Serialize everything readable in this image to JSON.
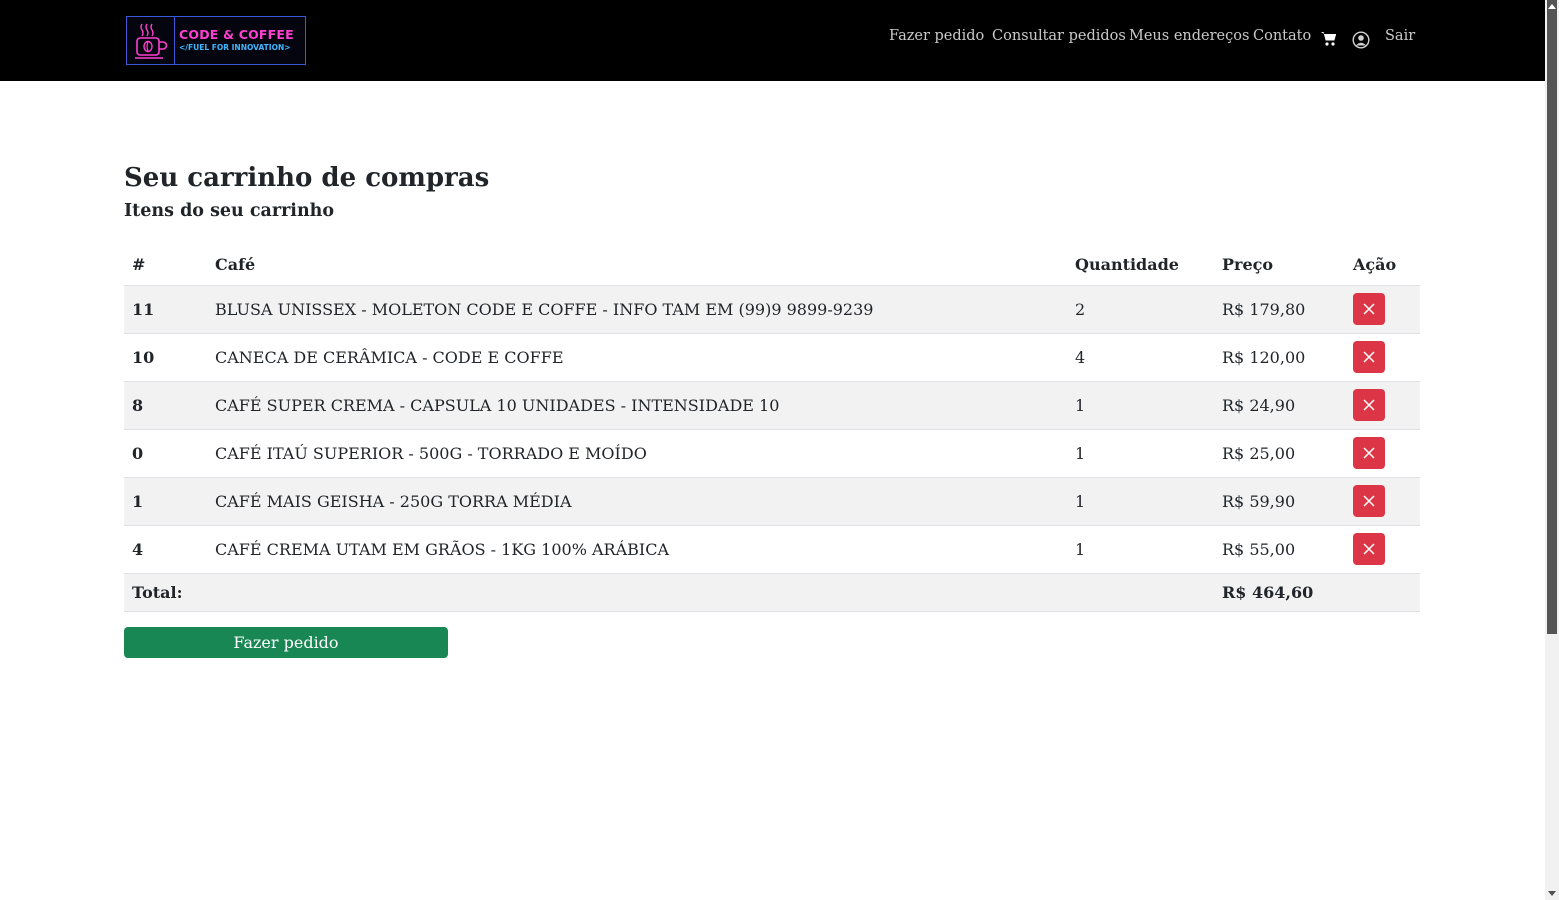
{
  "brand": {
    "title": "CODE & COFFEE",
    "tagline": "</FUEL FOR INNOVATION>",
    "colors": {
      "title": "#ff3fd0",
      "tagline": "#3fb7ff",
      "border": "#3a5bd9"
    }
  },
  "nav": {
    "links": [
      {
        "label": "Fazer pedido"
      },
      {
        "label": "Consultar pedidos"
      },
      {
        "label": "Meus endereços"
      },
      {
        "label": "Contato"
      }
    ],
    "cart_icon": "cart-icon",
    "user_icon": "user-circle-icon",
    "logout_label": "Sair"
  },
  "page": {
    "title": "Seu carrinho de compras",
    "subtitle": "Itens do seu carrinho"
  },
  "table": {
    "headers": {
      "id": "#",
      "product": "Café",
      "quantity": "Quantidade",
      "price": "Preço",
      "action": "Ação"
    },
    "rows": [
      {
        "id": "11",
        "product": "BLUSA UNISSEX - MOLETON CODE E COFFE - INFO TAM EM (99)9 9899-9239",
        "quantity": "2",
        "price": "R$ 179,80"
      },
      {
        "id": "10",
        "product": "CANECA DE CERÂMICA - CODE E COFFE",
        "quantity": "4",
        "price": "R$ 120,00"
      },
      {
        "id": "8",
        "product": "CAFÉ SUPER CREMA - CAPSULA 10 UNIDADES - INTENSIDADE 10",
        "quantity": "1",
        "price": "R$ 24,90"
      },
      {
        "id": "0",
        "product": "CAFÉ ITAÚ SUPERIOR - 500G - TORRADO E MOÍDO",
        "quantity": "1",
        "price": "R$ 25,00"
      },
      {
        "id": "1",
        "product": "CAFÉ MAIS GEISHA - 250G TORRA MÉDIA",
        "quantity": "1",
        "price": "R$ 59,90"
      },
      {
        "id": "4",
        "product": "CAFÉ CREMA UTAM EM GRÃOS - 1KG 100% ARÁBICA",
        "quantity": "1",
        "price": "R$ 55,00"
      }
    ],
    "remove_icon": "close-icon",
    "total_label": "Total:",
    "total_value": "R$ 464,60"
  },
  "actions": {
    "order_button": "Fazer pedido"
  },
  "colors": {
    "navbar": "#000000",
    "danger": "#dc3545",
    "success": "#198754",
    "stripe": "#f2f2f2"
  }
}
